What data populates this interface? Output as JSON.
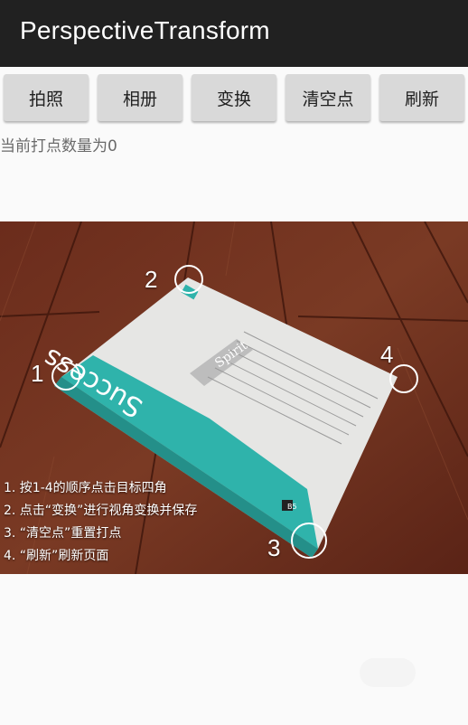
{
  "app": {
    "title": "PerspectiveTransform"
  },
  "buttons": {
    "take_photo": "拍照",
    "album": "相册",
    "transform": "变换",
    "clear_points": "清空点",
    "refresh": "刷新"
  },
  "status": {
    "point_count_text": "当前打点数量为0"
  },
  "image": {
    "markers": [
      "1",
      "2",
      "3",
      "4"
    ],
    "book": {
      "cover_title": "Success",
      "label": "Spirit",
      "size_badge": "B5"
    },
    "instructions": [
      "1. 按1-4的顺序点击目标四角",
      "2. 点击“变换”进行视角变换并保存",
      "3. “清空点”重置打点",
      "4. “刷新”刷新页面"
    ]
  }
}
